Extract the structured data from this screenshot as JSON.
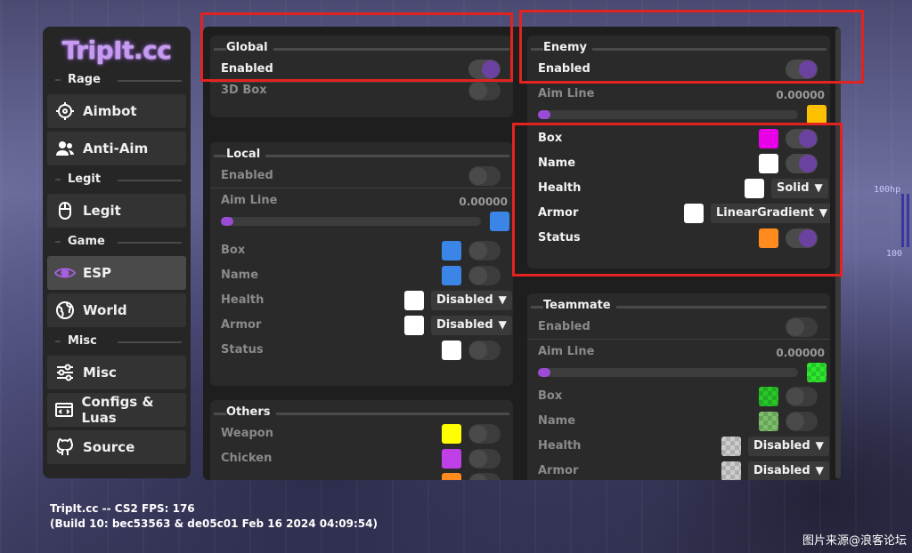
{
  "app": {
    "logo": "TripIt.cc"
  },
  "sidebar": {
    "categories": {
      "rage": "Rage",
      "legit": "Legit",
      "game": "Game",
      "misc": "Misc"
    },
    "items": [
      {
        "label": "Aimbot",
        "icon": "crosshair-icon"
      },
      {
        "label": "Anti-Aim",
        "icon": "users-icon"
      },
      {
        "label": "Legit",
        "icon": "mouse-icon"
      },
      {
        "label": "ESP",
        "icon": "eye-icon",
        "active": true
      },
      {
        "label": "World",
        "icon": "globe-icon"
      },
      {
        "label": "Misc",
        "icon": "sliders-icon"
      },
      {
        "label": "Configs & Luas",
        "icon": "code-window-icon"
      },
      {
        "label": "Source",
        "icon": "github-icon"
      }
    ]
  },
  "global": {
    "title": "Global",
    "enabled_label": "Enabled",
    "box3d_label": "3D Box"
  },
  "local": {
    "title": "Local",
    "enabled_label": "Enabled",
    "aimline_label": "Aim Line",
    "aimline_value": "0.00000",
    "box_label": "Box",
    "name_label": "Name",
    "health_label": "Health",
    "health_select": "Disabled",
    "armor_label": "Armor",
    "armor_select": "Disabled",
    "status_label": "Status"
  },
  "others": {
    "title": "Others",
    "weapon_label": "Weapon",
    "chicken_label": "Chicken"
  },
  "enemy": {
    "title": "Enemy",
    "enabled_label": "Enabled",
    "aimline_label": "Aim Line",
    "aimline_value": "0.00000",
    "box_label": "Box",
    "name_label": "Name",
    "health_label": "Health",
    "health_select": "Solid",
    "armor_label": "Armor",
    "armor_select": "LinearGradient",
    "status_label": "Status"
  },
  "teammate": {
    "title": "Teammate",
    "enabled_label": "Enabled",
    "aimline_label": "Aim Line",
    "aimline_value": "0.00000",
    "box_label": "Box",
    "name_label": "Name",
    "health_label": "Health",
    "health_select": "Disabled",
    "armor_label": "Armor",
    "armor_select": "Disabled"
  },
  "footer": {
    "line1": "TripIt.cc -- CS2 FPS: 176",
    "line2": "(Build 10: bec53563 & de05c01 Feb 16 2024 04:09:54)"
  },
  "hud": {
    "hp_top": "100hp",
    "hp_bottom": "100"
  },
  "watermark": "图片来源@浪客论坛",
  "colors": {
    "accent": "#9a4cd6",
    "toggle_on": "#6c42a0",
    "enemy_aimline": "#ffc000",
    "enemy_box": "#e800e8",
    "enemy_status": "#ff8a1e",
    "local_box": "#3a85e6",
    "others_weapon": "#ffff00",
    "others_chicken": "#c040e8",
    "teammate_aimline": "#2ee82e",
    "teammate_box": "#28c828",
    "teammate_name": "#7bbf6a"
  }
}
